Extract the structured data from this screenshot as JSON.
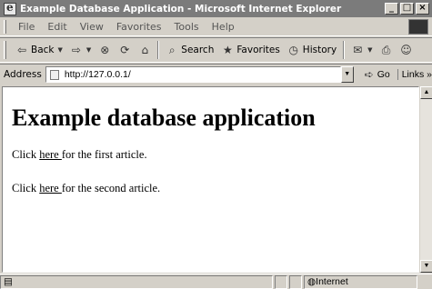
{
  "window": {
    "title": "Example Database Application - Microsoft Internet Explorer"
  },
  "window_controls": {
    "minimize": "_",
    "maximize": "□",
    "close": "×"
  },
  "menu": [
    "File",
    "Edit",
    "View",
    "Favorites",
    "Tools",
    "Help"
  ],
  "toolbar": {
    "back": "Back",
    "forward_icon": "forward-arrow",
    "search": "Search",
    "favorites": "Favorites",
    "history": "History"
  },
  "address": {
    "label": "Address",
    "url": "http://127.0.0.1/",
    "go": "Go",
    "links": "Links"
  },
  "page": {
    "heading": "Example database application",
    "para1_prefix": "Click ",
    "para1_link": "here ",
    "para1_suffix": "for the first article.",
    "para2_prefix": "Click ",
    "para2_link": "here ",
    "para2_suffix": "for the second article."
  },
  "status": {
    "zone": "Internet"
  }
}
